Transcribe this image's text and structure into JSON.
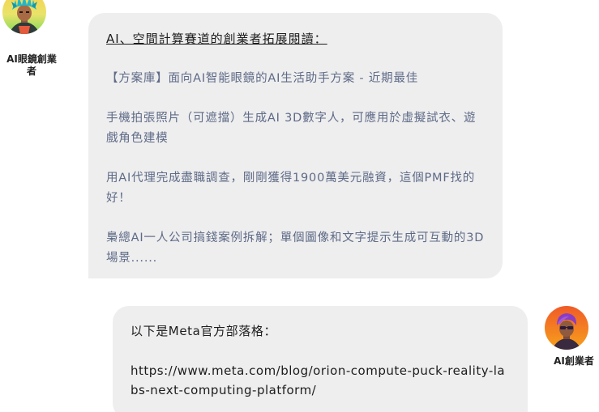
{
  "colors": {
    "bubble_background": "#eeeeef",
    "link_text": "#5e6a86",
    "primary_text": "#1c1c1c",
    "page_background": "#ffffff"
  },
  "left_message": {
    "sender": {
      "name": "AI眼鏡創業者",
      "avatar_icon": "cyan-hair-character-avatar-icon"
    },
    "heading": "AI、空間計算賽道的創業者拓展閱讀：",
    "items": [
      {
        "text": "【方案庫】面向AI智能眼鏡的AI生活助手方案 - 近期最佳"
      },
      {
        "text": "手機拍張照片（可遮擋）生成AI 3D數字人，可應用於虛擬試衣、遊戲角色建模"
      },
      {
        "text": "用AI代理完成盡職調查，剛剛獲得1900萬美元融資，這個PMF找的好！"
      },
      {
        "text": "梟總AI一人公司搞錢案例拆解；單個圖像和文字提示生成可互動的3D場景......"
      }
    ]
  },
  "right_message": {
    "sender": {
      "name": "AI創業者",
      "avatar_icon": "purple-hair-character-avatar-icon"
    },
    "text": "以下是Meta官方部落格：",
    "link": "https://www.meta.com/blog/orion-compute-puck-reality-labs-next-computing-platform/"
  }
}
